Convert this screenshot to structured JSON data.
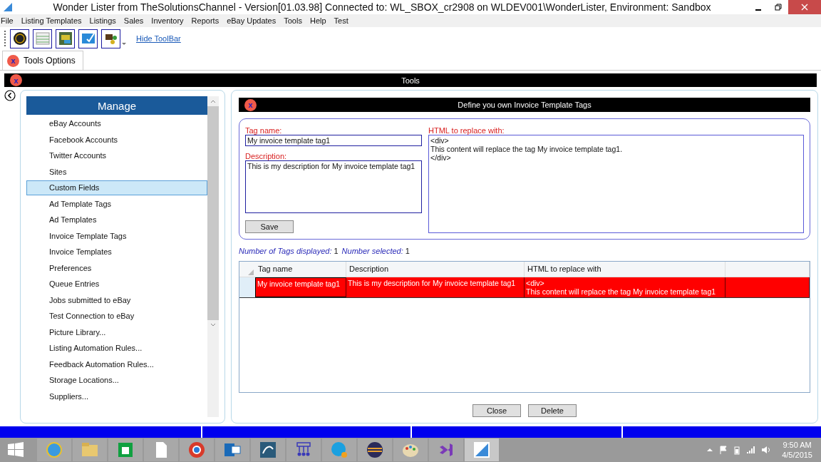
{
  "window": {
    "title": "Wonder Lister from TheSolutionsChannel - Version[01.03.98] Connected to: WL_SBOX_cr2908 on WLDEV001\\WonderLister, Environment: Sandbox"
  },
  "menu": [
    "File",
    "Listing Templates",
    "Listings",
    "Sales",
    "Inventory",
    "Reports",
    "eBay Updates",
    "Tools",
    "Help",
    "Test"
  ],
  "toolbar": {
    "link": "Hide ToolBar"
  },
  "doc_tabs": [
    {
      "label": "Tools Options",
      "close": "x",
      "selected": true
    }
  ],
  "tools_bar": {
    "close": "x",
    "title": "Tools"
  },
  "sidebar": {
    "header": "Manage",
    "items": [
      {
        "label": "eBay Accounts",
        "selected": false
      },
      {
        "label": "Facebook Accounts",
        "selected": false
      },
      {
        "label": "Twitter Accounts",
        "selected": false
      },
      {
        "label": "Sites",
        "selected": false
      },
      {
        "label": "Custom Fields",
        "selected": true
      },
      {
        "label": "Ad Template Tags",
        "selected": false
      },
      {
        "label": "Ad Templates",
        "selected": false
      },
      {
        "label": "Invoice Template Tags",
        "selected": false
      },
      {
        "label": "Invoice Templates",
        "selected": false
      },
      {
        "label": "Preferences",
        "selected": false
      },
      {
        "label": "Queue Entries",
        "selected": false
      },
      {
        "label": "Jobs submitted to eBay",
        "selected": false
      },
      {
        "label": "Test Connection to eBay",
        "selected": false
      },
      {
        "label": "Picture Library...",
        "selected": false
      },
      {
        "label": "Listing Automation Rules...",
        "selected": false
      },
      {
        "label": "Feedback Automation Rules...",
        "selected": false
      },
      {
        "label": "Storage Locations...",
        "selected": false
      },
      {
        "label": "Suppliers...",
        "selected": false
      }
    ]
  },
  "panel": {
    "close": "x",
    "title": "Define you own Invoice Template Tags",
    "tag_name": {
      "label": "Tag name:",
      "value": "My invoice template tag1"
    },
    "description": {
      "label": "Description:",
      "value": "This is my description for My invoice template tag1"
    },
    "html": {
      "label": "HTML to replace with:",
      "value": "<div>\nThis content will replace the tag My invoice template tag1.\n</div>"
    },
    "save": "Save",
    "summary": {
      "count_label": "Number of Tags displayed:",
      "count": "1",
      "selected_label": "Number selected:",
      "selected_count": "1"
    },
    "table": {
      "columns": [
        "Tag name",
        "Description",
        "HTML to replace with"
      ],
      "rows": [
        {
          "cells": [
            "My invoice template tag1",
            "This is my description for My invoice template tag1",
            "<div>\nThis content will replace the tag My invoice template tag1"
          ],
          "selected": true
        }
      ]
    },
    "buttons": [
      "Close",
      "Delete"
    ]
  },
  "taskbar": {
    "time": "9:50 AM",
    "date": "4/5/2015"
  }
}
